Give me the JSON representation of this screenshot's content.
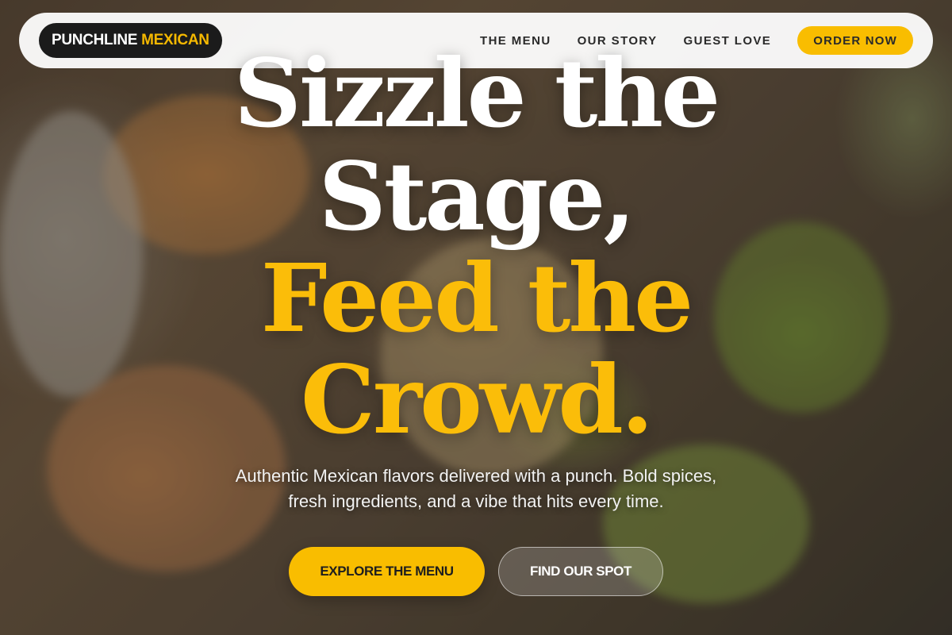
{
  "nav": {
    "logo_part1": "PUNCHLINE",
    "logo_part2": "MEXICAN",
    "links": [
      "THE MENU",
      "OUR STORY",
      "GUEST LOVE"
    ],
    "order_label": "ORDER NOW"
  },
  "hero": {
    "line1": "Sizzle the",
    "line2": "Stage,",
    "line3": "Feed the",
    "line4": "Crowd.",
    "subtext": "Authentic Mexican flavors delivered with a punch. Bold spices, fresh ingredients, and a vibe that hits every time.",
    "primary_cta": "EXPLORE THE MENU",
    "secondary_cta": "FIND OUR SPOT"
  },
  "colors": {
    "accent": "#f9bd00",
    "logo_bg": "#1b1b1b",
    "headline_white": "#ffffff",
    "headline_yellow": "#fbbd09"
  }
}
